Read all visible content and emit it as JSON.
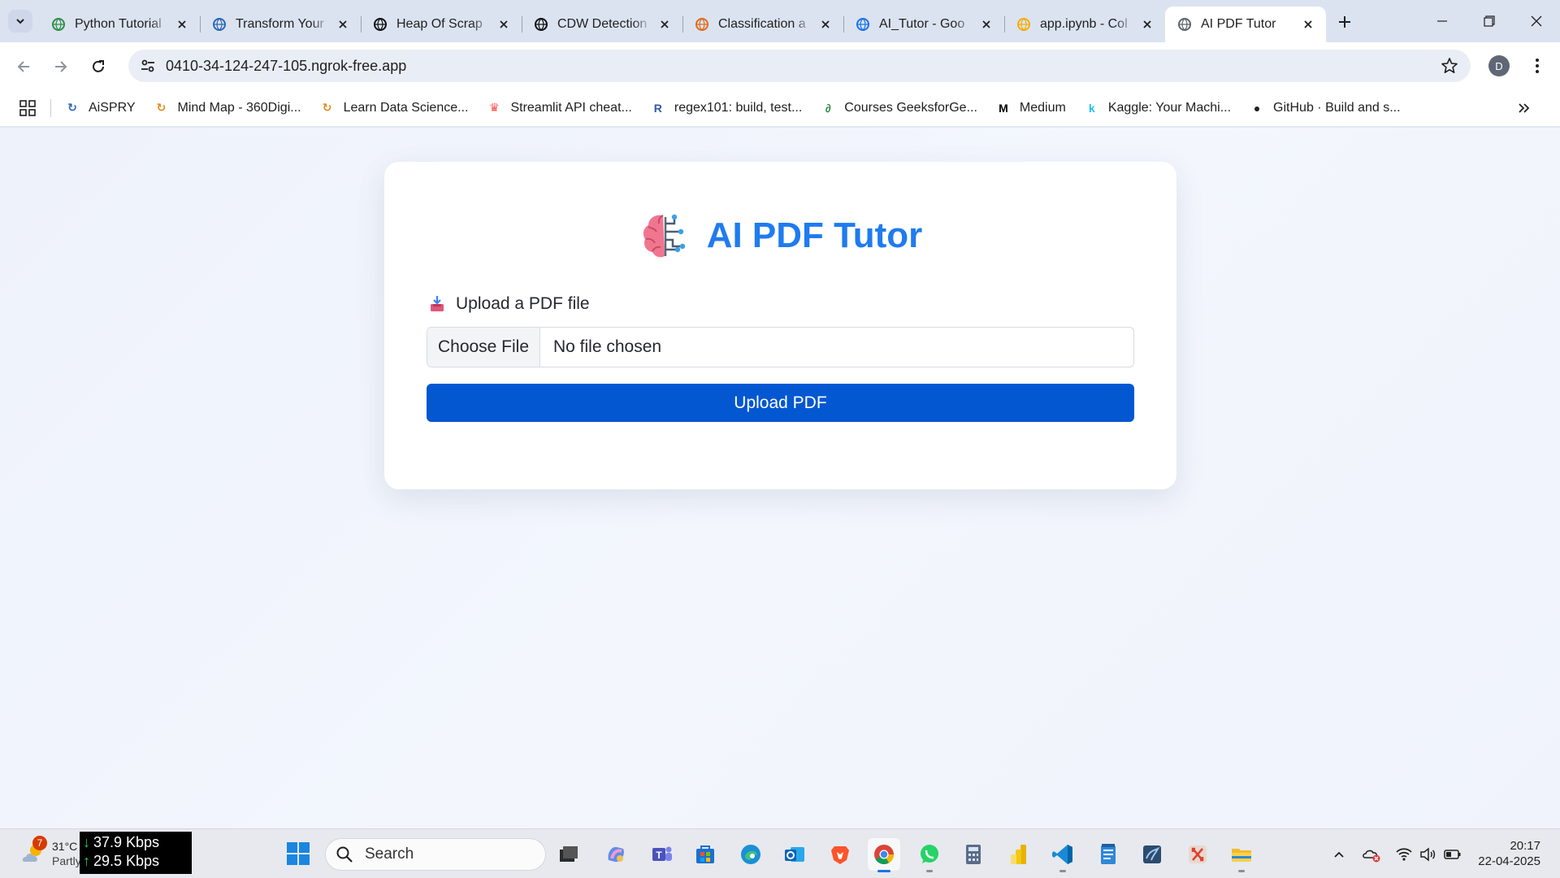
{
  "browser": {
    "tabs": [
      {
        "title": "Python Tutorial",
        "icon": "geeksforgeeks-icon",
        "color": "#2f8d46"
      },
      {
        "title": "Transform Your",
        "icon": "360digitmg-icon",
        "color": "#2a66b8"
      },
      {
        "title": "Heap Of Scrap",
        "icon": "heap-of-scrap-icon",
        "color": "#111111"
      },
      {
        "title": "CDW Detection",
        "icon": "openai-icon",
        "color": "#111111"
      },
      {
        "title": "Classification a",
        "icon": "e-letter-icon",
        "color": "#e36a1a"
      },
      {
        "title": "AI_Tutor - Goo",
        "icon": "google-drive-icon",
        "color": "#1a73e8"
      },
      {
        "title": "app.ipynb - Col",
        "icon": "colab-icon",
        "color": "#f9ab00"
      },
      {
        "title": "AI PDF Tutor",
        "icon": "globe-icon",
        "color": "#5f6368",
        "active": true
      }
    ],
    "url": "0410-34-124-247-105.ngrok-free.app",
    "profile_initial": "D",
    "bookmarks": [
      {
        "label": "AiSPRY",
        "icon": "aispry-icon",
        "glyph": "↻",
        "color": "#2a66b8"
      },
      {
        "label": "Mind Map - 360Digi...",
        "icon": "360digitmg-icon",
        "glyph": "↻",
        "color": "#e38a1a"
      },
      {
        "label": "Learn Data Science...",
        "icon": "360digitmg-icon",
        "glyph": "↻",
        "color": "#e38a1a"
      },
      {
        "label": "Streamlit API cheat...",
        "icon": "streamlit-icon",
        "glyph": "♛",
        "color": "#ff4b4b"
      },
      {
        "label": "regex101: build, test...",
        "icon": "regex101-icon",
        "glyph": "R",
        "color": "#2e5b9e"
      },
      {
        "label": "Courses GeeksforGe...",
        "icon": "geeksforgeeks-icon",
        "glyph": "∂",
        "color": "#2f8d46"
      },
      {
        "label": "Medium",
        "icon": "medium-icon",
        "glyph": "M",
        "color": "#000000"
      },
      {
        "label": "Kaggle: Your Machi...",
        "icon": "kaggle-icon",
        "glyph": "k",
        "color": "#20beff"
      },
      {
        "label": "GitHub · Build and s...",
        "icon": "github-icon",
        "glyph": "●",
        "color": "#1f1f1f"
      }
    ]
  },
  "app": {
    "title": "AI PDF Tutor",
    "title_icon": "brain-circuit-icon",
    "upload_label": "Upload a PDF file",
    "upload_label_icon": "inbox-tray-icon",
    "choose_file_label": "Choose File",
    "file_status": "No file chosen",
    "upload_button_label": "Upload PDF",
    "accent_color": "#1f7bf0",
    "button_color": "#0357d1"
  },
  "taskbar": {
    "weather": {
      "badge": "7",
      "temp": "31°C",
      "condition": "Partly"
    },
    "network": {
      "down": "37.9 Kbps",
      "up": "29.5 Kbps"
    },
    "search_placeholder": "Search",
    "apps": [
      "task-view-icon",
      "copilot-icon",
      "teams-icon",
      "store-icon",
      "edge-icon",
      "outlook-icon",
      "brave-icon",
      "chrome-icon",
      "whatsapp-icon",
      "calculator-icon",
      "powerbi-icon",
      "vscode-icon",
      "notepad-icon",
      "sql-workbench-icon",
      "xampp-icon",
      "file-explorer-icon"
    ],
    "time": "20:17",
    "date": "22-04-2025"
  }
}
